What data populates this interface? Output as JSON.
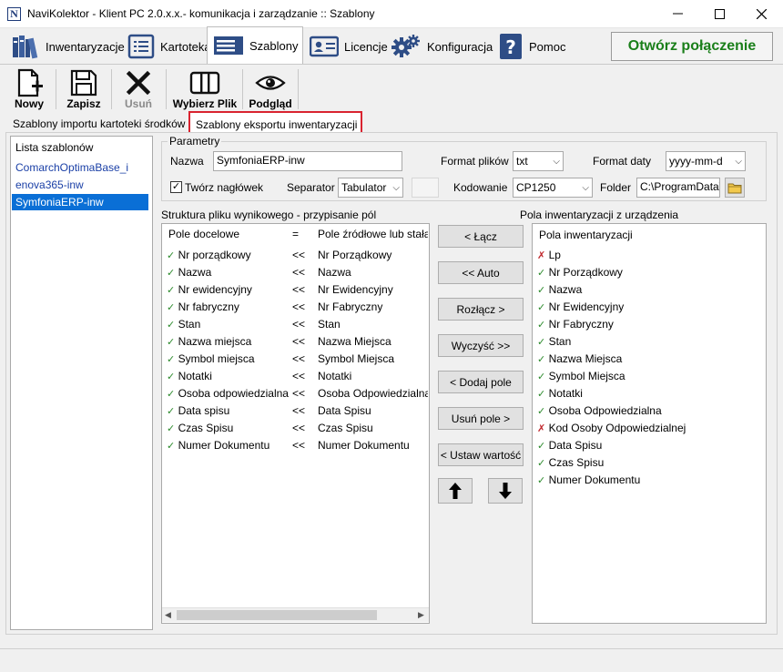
{
  "window": {
    "title": "NaviKolektor - Klient PC 2.0.x.x.- komunikacja i zarządzanie :: Szablony",
    "app_icon_letter": "N"
  },
  "main_tabs": [
    {
      "label": "Inwentaryzacje",
      "icon": "books-icon"
    },
    {
      "label": "Kartoteka",
      "icon": "list-icon"
    },
    {
      "label": "Szablony",
      "icon": "template-icon",
      "active": true
    },
    {
      "label": "Licencje",
      "icon": "id-card-icon"
    },
    {
      "label": "Konfiguracja",
      "icon": "gears-icon"
    },
    {
      "label": "Pomoc",
      "icon": "help-icon"
    }
  ],
  "connect_button": "Otwórz połączenie",
  "toolbar": {
    "new": "Nowy",
    "save": "Zapisz",
    "delete": "Usuń",
    "choose_file": "Wybierz Plik",
    "preview": "Podgląd"
  },
  "subtabs": [
    "Szablony importu kartoteki środków",
    "Szablony eksportu inwentaryzacji"
  ],
  "templates": {
    "header": "Lista szablonów",
    "items": [
      "ComarchOptimaBase_i",
      "enova365-inw",
      "SymfoniaERP-inw"
    ],
    "selected_index": 2
  },
  "params": {
    "group_label": "Parametry",
    "name_label": "Nazwa",
    "name_value": "SymfoniaERP-inw",
    "file_format_label": "Format plików",
    "file_format_value": "txt",
    "date_format_label": "Format daty",
    "date_format_value": "yyyy-mm-d",
    "header_checkbox_label": "Twórz nagłówek",
    "header_checked": true,
    "separator_label": "Separator",
    "separator_value": "Tabulator",
    "encoding_label": "Kodowanie",
    "encoding_value": "CP1250",
    "folder_label": "Folder",
    "folder_value": "C:\\ProgramData\\"
  },
  "structure": {
    "title": "Struktura pliku wynikowego - przypisanie pól",
    "headers": [
      "Pole docelowe",
      "=",
      "Pole źródłowe lub stała"
    ],
    "rows": [
      {
        "target": "Nr porządkowy",
        "op": "<<",
        "source": "Nr Porządkowy"
      },
      {
        "target": "Nazwa",
        "op": "<<",
        "source": "Nazwa"
      },
      {
        "target": "Nr ewidencyjny",
        "op": "<<",
        "source": "Nr Ewidencyjny"
      },
      {
        "target": "Nr fabryczny",
        "op": "<<",
        "source": "Nr Fabryczny"
      },
      {
        "target": "Stan",
        "op": "<<",
        "source": "Stan"
      },
      {
        "target": "Nazwa miejsca",
        "op": "<<",
        "source": "Nazwa Miejsca"
      },
      {
        "target": "Symbol miejsca",
        "op": "<<",
        "source": "Symbol Miejsca"
      },
      {
        "target": "Notatki",
        "op": "<<",
        "source": "Notatki"
      },
      {
        "target": "Osoba odpowiedzialna",
        "op": "<<",
        "source": "Osoba Odpowiedzialna"
      },
      {
        "target": "Data spisu",
        "op": "<<",
        "source": "Data Spisu"
      },
      {
        "target": "Czas Spisu",
        "op": "<<",
        "source": "Czas Spisu"
      },
      {
        "target": "Numer Dokumentu",
        "op": "<<",
        "source": "Numer Dokumentu"
      }
    ]
  },
  "actions": {
    "connect": "< Łącz",
    "auto": "<< Auto",
    "disconnect": "Rozłącz >",
    "clear": "Wyczyść >>",
    "add_field": "< Dodaj pole",
    "remove_field": "Usuń pole >",
    "set_value": "< Ustaw wartość"
  },
  "inventory_fields": {
    "title": "Pola inwentaryzacji z urządzenia",
    "header": "Pola inwentaryzacji",
    "items": [
      {
        "label": "Lp",
        "mapped": false
      },
      {
        "label": "Nr Porządkowy",
        "mapped": true
      },
      {
        "label": "Nazwa",
        "mapped": true
      },
      {
        "label": "Nr Ewidencyjny",
        "mapped": true
      },
      {
        "label": "Nr Fabryczny",
        "mapped": true
      },
      {
        "label": "Stan",
        "mapped": true
      },
      {
        "label": "Nazwa Miejsca",
        "mapped": true
      },
      {
        "label": "Symbol Miejsca",
        "mapped": true
      },
      {
        "label": "Notatki",
        "mapped": true
      },
      {
        "label": "Osoba Odpowiedzialna",
        "mapped": true
      },
      {
        "label": "Kod Osoby Odpowiedzialnej",
        "mapped": false
      },
      {
        "label": "Data Spisu",
        "mapped": true
      },
      {
        "label": "Czas Spisu",
        "mapped": true
      },
      {
        "label": "Numer Dokumentu",
        "mapped": true
      }
    ]
  },
  "glyphs": {
    "check": "✓",
    "cross": "✗",
    "caret": "⌵"
  }
}
